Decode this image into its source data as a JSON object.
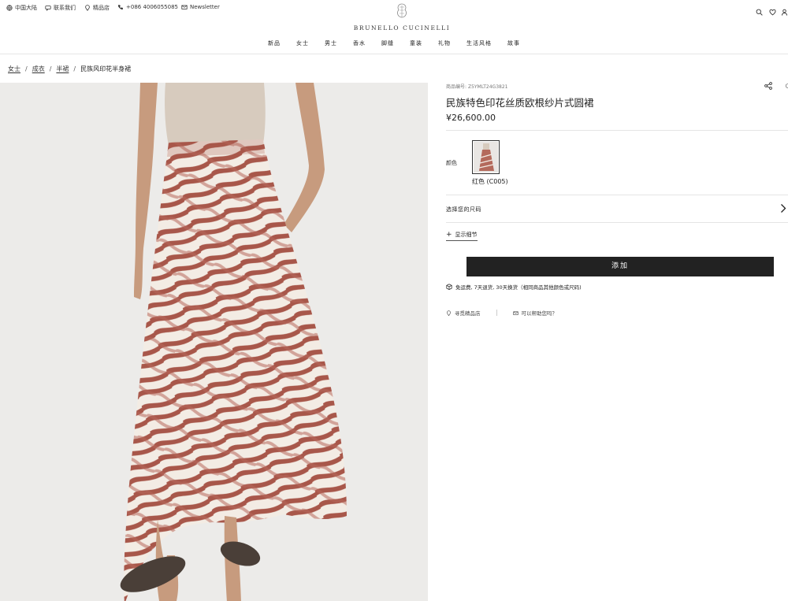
{
  "topbar": {
    "region": "中国大陆",
    "contact": "联系我们",
    "boutique": "精品店",
    "phone": "+086 4006055085",
    "newsletter": "Newsletter"
  },
  "brand": {
    "name": "BRUNELLO CUCINELLI"
  },
  "nav": {
    "items": [
      "新品",
      "女士",
      "男士",
      "香水",
      "脚缝",
      "童装",
      "礼物",
      "生活风格",
      "故事"
    ]
  },
  "breadcrumb": {
    "items": [
      "女士",
      "成衣",
      "半裙"
    ],
    "current": "民族风印花半身裙"
  },
  "product": {
    "sku_label": "商品编号:",
    "sku": "Z5YMLT24G3821",
    "title": "民族特色印花丝质欧根纱片式圆裙",
    "price": "¥26,600.00",
    "color_label": "颜色",
    "color_name": "红色 (C005)",
    "size_label": "选择您的尺码",
    "details_label": "显示细节",
    "add_label": "添加",
    "shipping_text": "免运费, 7天退货, 30天换货（相同商品其他颜色或尺码)",
    "store_label": "寻觅精品店",
    "help_label": "可以帮助您吗？"
  },
  "colors": {
    "stripe": "#a8574a",
    "cream": "#f3ece4",
    "button": "#222222"
  },
  "icons": [
    "globe-icon",
    "chat-icon",
    "location-pin-icon",
    "phone-icon",
    "mail-icon",
    "search-icon",
    "heart-icon",
    "user-icon",
    "share-icon",
    "chevron-right-icon",
    "plus-icon",
    "box-icon",
    "envelope-icon"
  ]
}
